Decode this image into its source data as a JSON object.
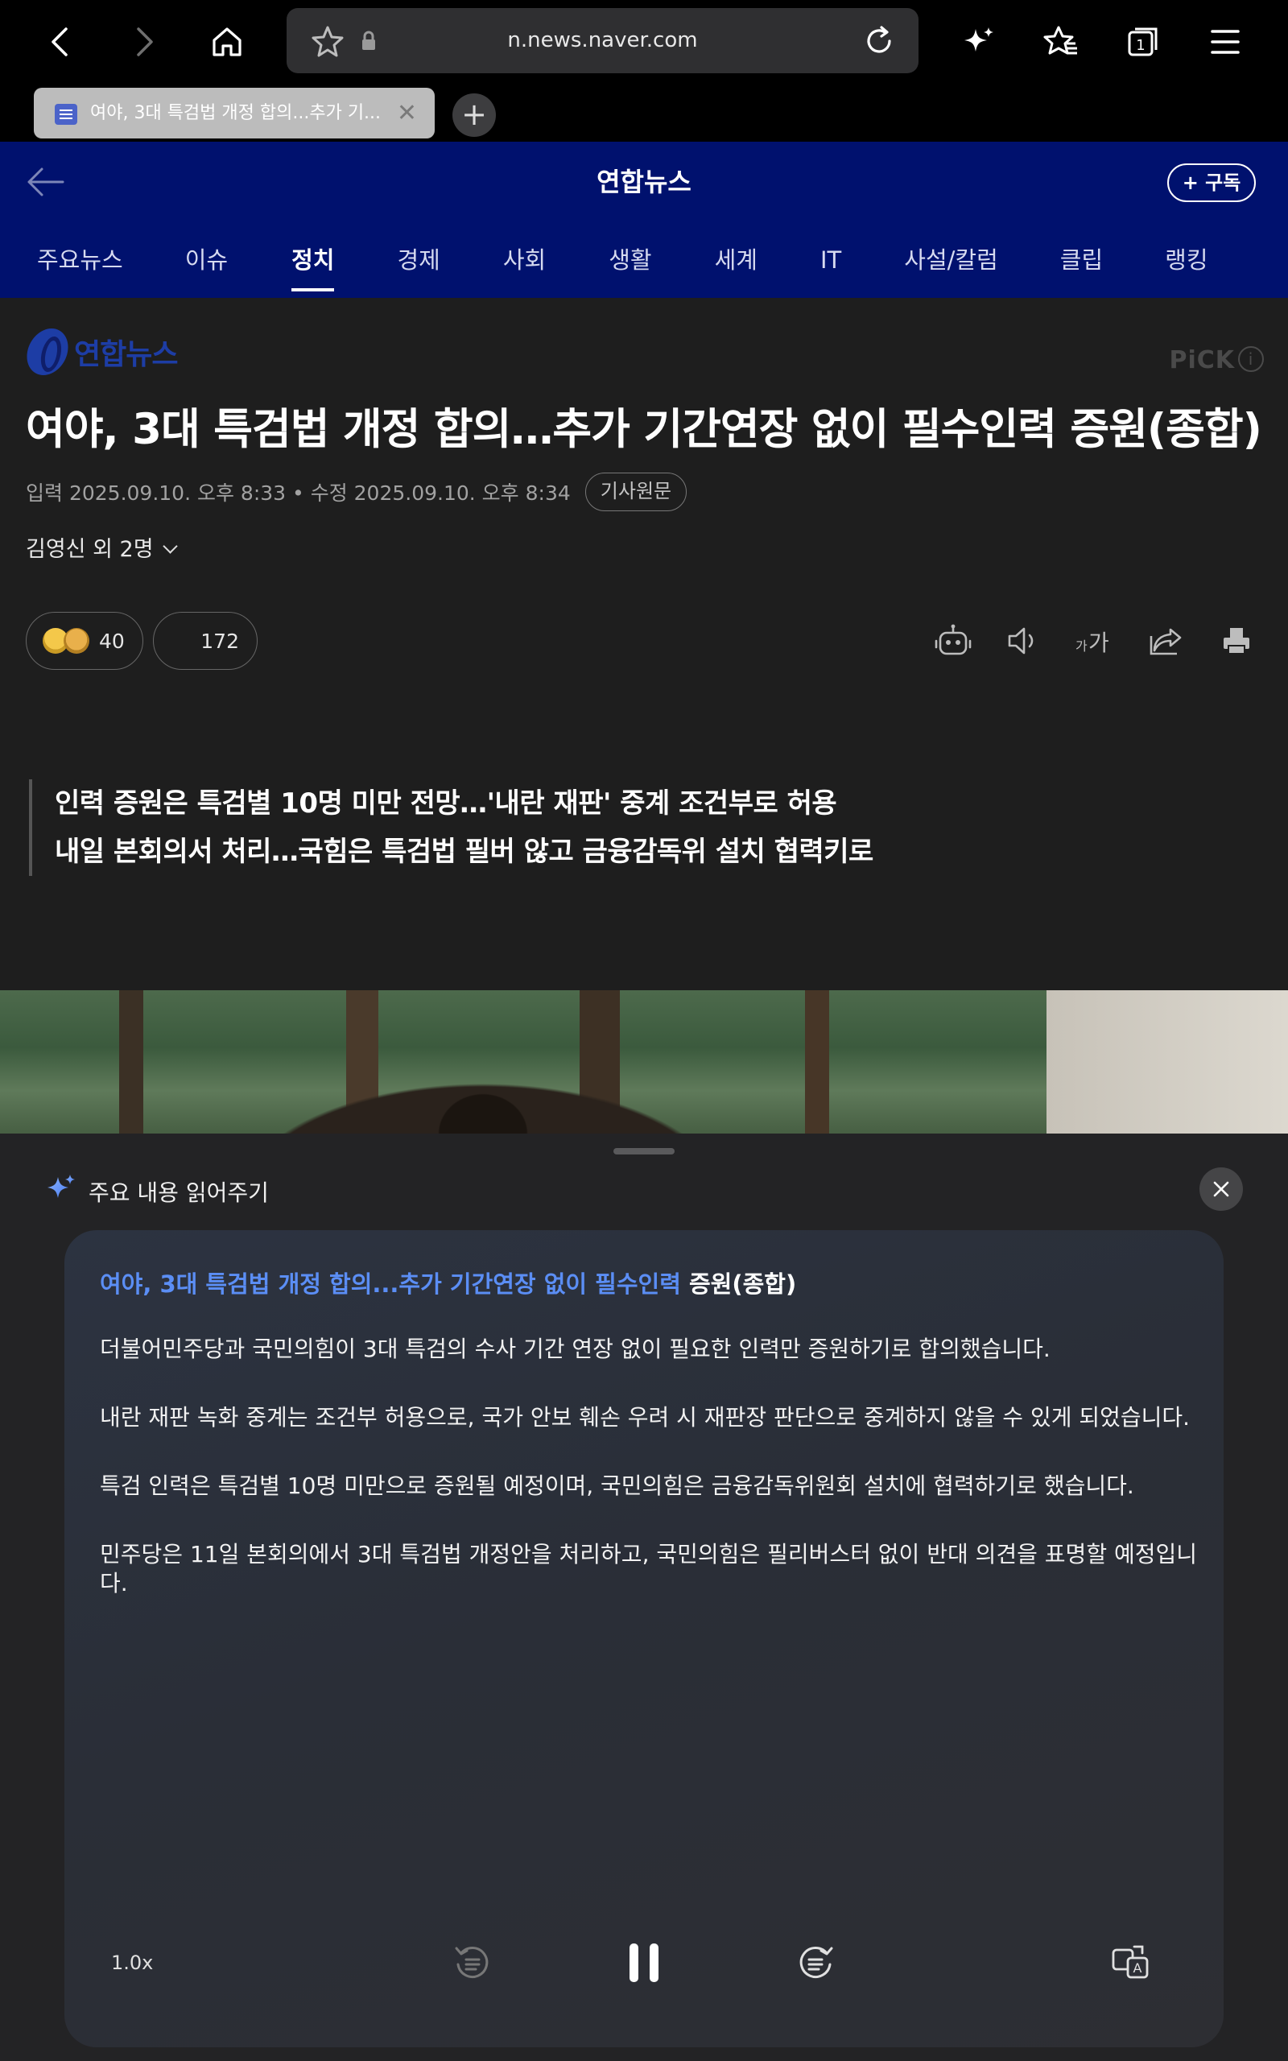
{
  "browser": {
    "url": "n.news.naver.com",
    "tab_title": "여야, 3대 특검법 개정 합의...추가 기...",
    "tab_close": "✕",
    "new_tab": "+"
  },
  "site": {
    "brand": "연합뉴스",
    "subscribe_label": "+ 구독",
    "categories": [
      "주요뉴스",
      "이슈",
      "정치",
      "경제",
      "사회",
      "생활",
      "세계",
      "IT",
      "사설/칼럼",
      "클립",
      "랭킹"
    ],
    "active_category": "정치"
  },
  "article": {
    "publisher_logo": "연합뉴스",
    "pick_label": "PiCK",
    "pick_info": "i",
    "headline": "여야, 3대 특검법 개정 합의…추가 기간연장 없이 필수인력 증원(종합)",
    "dateline": "입력 2025.09.10. 오후 8:33 • 수정 2025.09.10. 오후 8:34",
    "original_link_label": "기사원문",
    "byline": "김영신 외 2명",
    "reactions_count": "40",
    "comments_count": "172",
    "summary_lines": [
      "인력 증원은 특검별 10명 미만 전망…'내란 재판' 중계 조건부로 허용",
      "내일 본회의서 처리…국힘은 특검법 필버 않고 금융감독위 설치 협력키로"
    ]
  },
  "reader_sheet": {
    "title": "주요 내용 읽어주기",
    "card_title_highlight": "여야, 3대 특검법 개정 합의...추가 기간연장 없이 필수인력",
    "card_title_rest": " 증원(종합)",
    "paragraphs": [
      "더불어민주당과 국민의힘이 3대 특검의 수사 기간 연장 없이 필요한 인력만 증원하기로 합의했습니다.",
      "내란 재판 녹화 중계는 조건부 허용으로, 국가 안보 훼손 우려 시 재판장 판단으로 중계하지 않을 수 있게 되었습니다.",
      "특검 인력은 특검별 10명 미만으로 증원될 예정이며, 국민의힘은 금융감독위원회 설치에 협력하기로 했습니다.",
      "민주당은 11일 본회의에서 3대 특검법 개정안을 처리하고, 국민의힘은 필리버스터 없이 반대 의견을 표명할 예정입니다."
    ],
    "speed": "1.0x",
    "accent_color": "#5b8ef5"
  }
}
